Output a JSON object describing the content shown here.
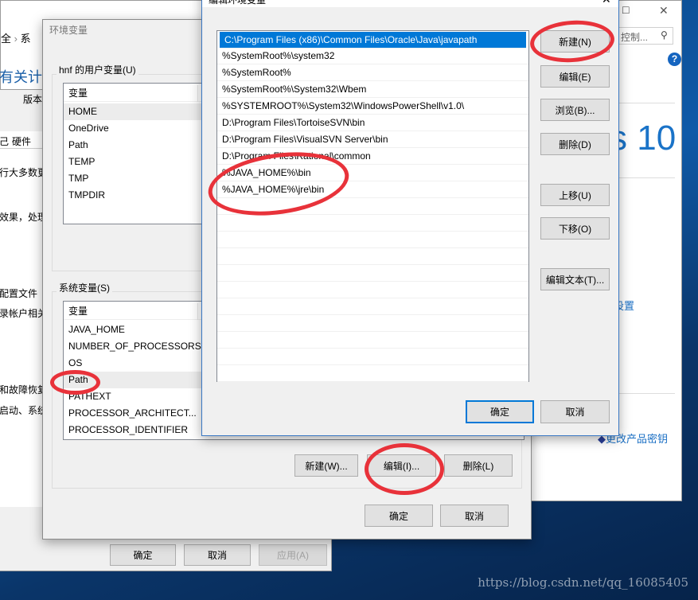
{
  "control_panel": {
    "breadcrumb": [
      "全",
      "›",
      "系"
    ],
    "heading": "有关计算",
    "version_label": "版本",
    "tabs": [
      "己",
      "硬件"
    ],
    "texts": [
      "行大多数更",
      "效果，处理",
      "配置文件",
      "录帐户相关",
      "和故障恢复",
      "启动、系统"
    ],
    "search_placeholder": "控制...",
    "help_icon": "?",
    "windows_brand": "s 10",
    "settings_link": "设置",
    "product_key_link": "更改产品密钥",
    "maximize_icon": "□",
    "close_icon": "✕"
  },
  "system_properties": {
    "ok": "确定",
    "cancel": "取消",
    "apply": "应用(A)"
  },
  "env_dialog": {
    "title": "环境变量",
    "user_group": "hnf 的用户变量(U)",
    "user_header": "变量",
    "user_vars": [
      "HOME",
      "OneDrive",
      "Path",
      "TEMP",
      "TMP",
      "TMPDIR"
    ],
    "system_group": "系统变量(S)",
    "system_header": "变量",
    "system_vars": [
      "JAVA_HOME",
      "NUMBER_OF_PROCESSORS",
      "OS",
      "Path",
      "PATHEXT",
      "PROCESSOR_ARCHITECT...",
      "PROCESSOR_IDENTIFIER"
    ],
    "new_button": "新建(W)...",
    "edit_button": "编辑(I)...",
    "delete_button": "删除(L)",
    "ok": "确定",
    "cancel": "取消"
  },
  "edit_dialog": {
    "title": "编辑环境变量",
    "close_icon": "✕",
    "paths": [
      "C:\\Program Files (x86)\\Common Files\\Oracle\\Java\\javapath",
      "%SystemRoot%\\system32",
      "%SystemRoot%",
      "%SystemRoot%\\System32\\Wbem",
      "%SYSTEMROOT%\\System32\\WindowsPowerShell\\v1.0\\",
      "D:\\Program Files\\TortoiseSVN\\bin",
      "D:\\Program Files\\VisualSVN Server\\bin",
      "D:\\Program Files\\Rational\\common",
      "%JAVA_HOME%\\bin",
      "%JAVA_HOME%\\jre\\bin"
    ],
    "selected_index": 0,
    "buttons": {
      "new": "新建(N)",
      "edit": "编辑(E)",
      "browse": "浏览(B)...",
      "delete": "删除(D)",
      "move_up": "上移(U)",
      "move_down": "下移(O)",
      "edit_text": "编辑文本(T)..."
    },
    "ok": "确定",
    "cancel": "取消"
  },
  "annotation_color": "#e8323a",
  "watermark": "https://blog.csdn.net/qq_16085405"
}
